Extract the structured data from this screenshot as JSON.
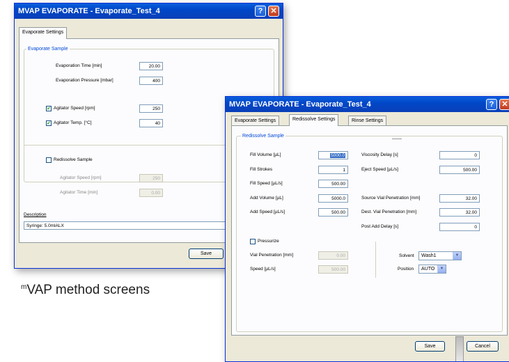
{
  "window1": {
    "title": "MVAP EVAPORATE - Evaporate_Test_4",
    "tab": "Evaporate Settings",
    "group_title": "Evaporate Sample",
    "evap_time_label": "Evaporation Time [min]",
    "evap_time_value": "20.00",
    "evap_pressure_label": "Evaporation Pressure [mbar]",
    "evap_pressure_value": "400",
    "agitator_speed_label": "Agitator Speed [rpm]",
    "agitator_speed_value": "250",
    "agitator_temp_label": "Agitator Temp. [°C]",
    "agitator_temp_value": "40",
    "redissolve_label": "Redissolve Sample",
    "redissolve_speed_label": "Agitator Speed [rpm]",
    "redissolve_speed_value": "250",
    "redissolve_time_label": "Agitator Time [min]",
    "redissolve_time_value": "0.00",
    "description_label": "Description",
    "description_value": "Syringe: 5.0mlALX",
    "save_label": "Save"
  },
  "window2": {
    "title": "MVAP EVAPORATE - Evaporate_Test_4",
    "tabs": [
      "Evaporate Settings",
      "Redissolve Settings",
      "Rinse Settings"
    ],
    "group_title": "Redissolve Sample",
    "fill_volume_label": "Fill Volume [µL]",
    "fill_volume_value": "5000.0",
    "fill_strokes_label": "Fill Strokes",
    "fill_strokes_value": "1",
    "fill_speed_label": "Fill Speed [µL/s]",
    "fill_speed_value": "500.00",
    "add_volume_label": "Add Volume [µL]",
    "add_volume_value": "5000.0",
    "add_speed_label": "Add Speed [µL/s]",
    "add_speed_value": "500.00",
    "viscosity_delay_label": "Viscosity Delay [s]",
    "viscosity_delay_value": "0",
    "eject_speed_label": "Eject Speed [µL/s]",
    "eject_speed_value": "500.00",
    "source_vial_label": "Source Vial Penetration [mm]",
    "source_vial_value": "32.00",
    "dest_vial_label": "Dest. Vial Penetration [mm]",
    "dest_vial_value": "32.00",
    "post_add_label": "Post Add Delay [s]",
    "post_add_value": "0",
    "pressurize_label": "Pressurize",
    "vial_pen_label": "Vial Penetration [mm]",
    "vial_pen_value": "0.00",
    "speed_label": "Speed [µL/s]",
    "speed_value": "500.00",
    "solvent_label": "Solvent",
    "solvent_value": "Wash1",
    "position_label": "Position",
    "position_value": "AUTO",
    "save_label": "Save",
    "cancel_label": "Cancel"
  },
  "caption": {
    "prefix": "m",
    "text": "VAP method screens"
  },
  "colors": {
    "titlebar": "#0a5fdc",
    "dialog_bg": "#ece9d8",
    "selection": "#316ac5",
    "group_title": "#0046d5"
  }
}
